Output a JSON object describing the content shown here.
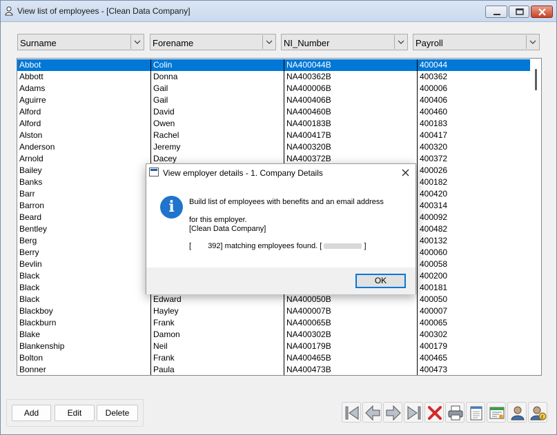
{
  "window": {
    "title": "View list of employees - [Clean Data Company]"
  },
  "filters": [
    {
      "label": "Surname"
    },
    {
      "label": "Forename"
    },
    {
      "label": "NI_Number"
    },
    {
      "label": "Payroll"
    }
  ],
  "rows": [
    [
      "Abbot",
      "Colin",
      "NA400044B",
      "400044"
    ],
    [
      "Abbott",
      "Donna",
      "NA400362B",
      "400362"
    ],
    [
      "Adams",
      "Gail",
      "NA400006B",
      "400006"
    ],
    [
      "Aguirre",
      "Gail",
      "NA400406B",
      "400406"
    ],
    [
      "Alford",
      "David",
      "NA400460B",
      "400460"
    ],
    [
      "Alford",
      "Owen",
      "NA400183B",
      "400183"
    ],
    [
      "Alston",
      "Rachel",
      "NA400417B",
      "400417"
    ],
    [
      "Anderson",
      "Jeremy",
      "NA400320B",
      "400320"
    ],
    [
      "Arnold",
      "Dacey",
      "NA400372B",
      "400372"
    ],
    [
      "Bailey",
      "",
      "",
      "400026"
    ],
    [
      "Banks",
      "",
      "",
      "400182"
    ],
    [
      "Barr",
      "",
      "",
      "400420"
    ],
    [
      "Barron",
      "",
      "",
      "400314"
    ],
    [
      "Beard",
      "",
      "",
      "400092"
    ],
    [
      "Bentley",
      "",
      "",
      "400482"
    ],
    [
      "Berg",
      "",
      "",
      "400132"
    ],
    [
      "Berry",
      "",
      "",
      "400060"
    ],
    [
      "Bevlin",
      "",
      "",
      "400058"
    ],
    [
      "Black",
      "",
      "",
      "400200"
    ],
    [
      "Black",
      "",
      "",
      "400181"
    ],
    [
      "Black",
      "Edward",
      "NA400050B",
      "400050"
    ],
    [
      "Blackboy",
      "Hayley",
      "NA400007B",
      "400007"
    ],
    [
      "Blackburn",
      "Frank",
      "NA400065B",
      "400065"
    ],
    [
      "Blake",
      "Damon",
      "NA400302B",
      "400302"
    ],
    [
      "Blankenship",
      "Neil",
      "NA400179B",
      "400179"
    ],
    [
      "Bolton",
      "Frank",
      "NA400465B",
      "400465"
    ],
    [
      "Bonner",
      "Paula",
      "NA400473B",
      "400473"
    ]
  ],
  "selected_row": 0,
  "dialog": {
    "title": "View employer details - 1. Company Details",
    "line1": "Build list of employees with benefits and an email address",
    "line2": "for this employer.",
    "line3": "[Clean Data Company]",
    "count_prefix": "[",
    "count_value": "392]",
    "count_text": "matching employees found. [",
    "count_suffix": "]",
    "ok_label": "OK",
    "icon": "info-icon"
  },
  "buttons": {
    "add": "Add",
    "edit": "Edit",
    "delete": "Delete"
  },
  "toolbar": [
    {
      "name": "first-record-icon"
    },
    {
      "name": "previous-record-icon"
    },
    {
      "name": "next-record-icon"
    },
    {
      "name": "last-record-icon"
    },
    {
      "name": "delete-record-icon"
    },
    {
      "name": "print-icon"
    },
    {
      "name": "notepad-icon"
    },
    {
      "name": "form-list-icon"
    },
    {
      "name": "employee-icon"
    },
    {
      "name": "employee-pay-icon"
    }
  ],
  "colors": {
    "selection": "#0078d7",
    "info": "#1f74cc",
    "delete": "#d62828"
  }
}
